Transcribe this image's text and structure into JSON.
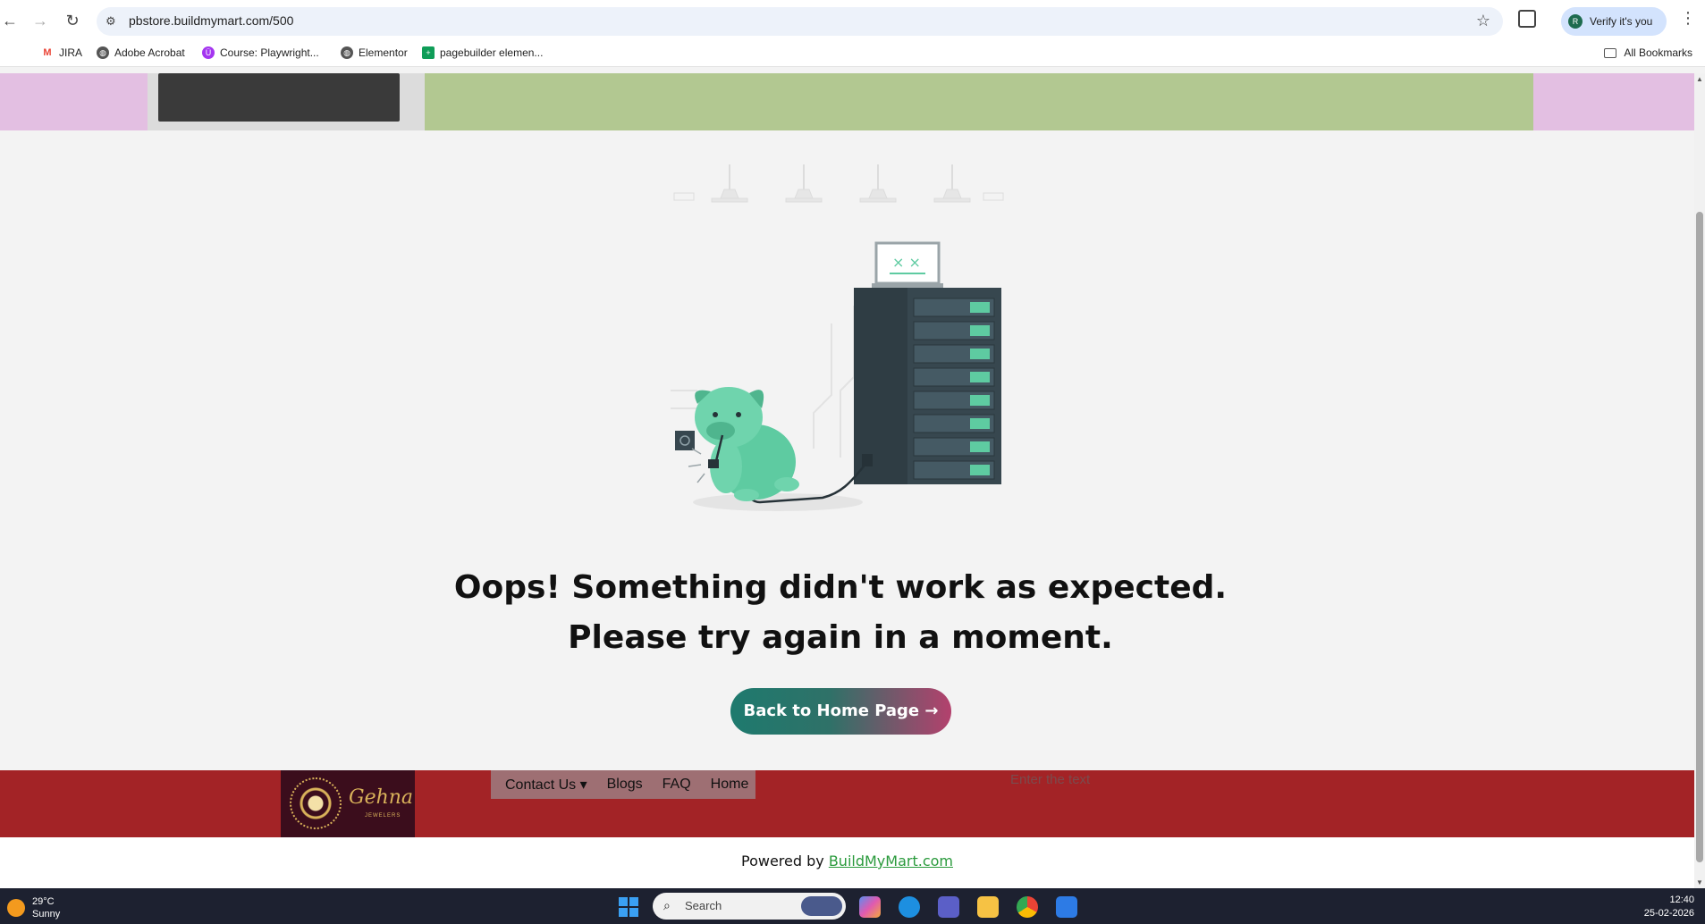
{
  "browser": {
    "url": "pbstore.buildmymart.com/500",
    "profile_label": "Verify it's you",
    "profile_initial": "R",
    "bookmarks": [
      {
        "label": "JIRA",
        "icon": "gmail-icon",
        "color": "#ea4335"
      },
      {
        "label": "Adobe Acrobat",
        "icon": "globe-icon",
        "color": "#555555"
      },
      {
        "label": "Course: Playwright...",
        "icon": "udemy-icon",
        "color": "#a435f0"
      },
      {
        "label": "Elementor",
        "icon": "globe-icon",
        "color": "#555555"
      },
      {
        "label": "pagebuilder elemen...",
        "icon": "sheets-icon",
        "color": "#0f9d58"
      }
    ],
    "all_bookmarks_label": "All Bookmarks"
  },
  "error_page": {
    "line1": "Oops! Something didn't work as expected.",
    "line2": "Please try again in a moment.",
    "home_button": "Back to Home Page →"
  },
  "footer": {
    "logo_brand": "Gehna",
    "logo_sub": "JEWELERS",
    "nav": [
      {
        "label": "Contact Us ▾",
        "name": "contact-us"
      },
      {
        "label": "Blogs",
        "name": "blogs"
      },
      {
        "label": "FAQ",
        "name": "faq"
      },
      {
        "label": "Home",
        "name": "home"
      }
    ],
    "search_placeholder": "Enter the text",
    "powered_prefix": "Powered by ",
    "powered_link": "BuildMyMart.com"
  },
  "taskbar": {
    "temperature": "29°C",
    "weather": "Sunny",
    "search_placeholder": "Search",
    "time": "12:40",
    "date": "25-02-2026"
  },
  "colors": {
    "footer_bg": "#a32326",
    "button_start": "#1e7a6e",
    "button_end": "#b3416d",
    "link_green": "#2a9a3c"
  }
}
